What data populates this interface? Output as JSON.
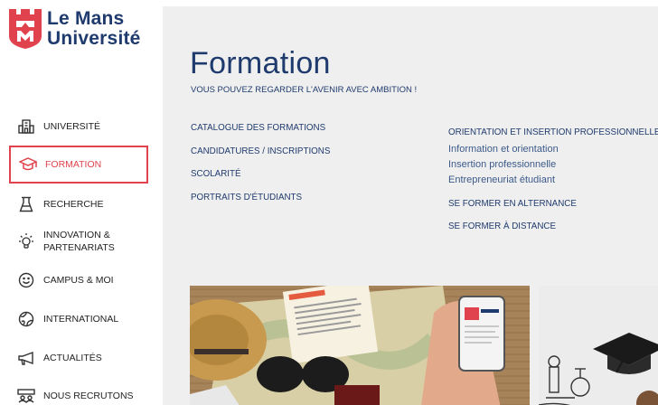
{
  "brand": {
    "line1": "Le Mans",
    "line2": "Université",
    "color": "#1f3b6e",
    "logo_color": "#e0434d"
  },
  "nav": {
    "active_color": "#e0434d",
    "items": [
      {
        "label": "UNIVERSITÉ",
        "icon": "building-icon"
      },
      {
        "label": "FORMATION",
        "icon": "graduation-cap-icon",
        "active": true
      },
      {
        "label": "RECHERCHE",
        "icon": "flask-icon"
      },
      {
        "label": "INNOVATION &",
        "label2": "PARTENARIATS",
        "icon": "lightbulb-icon"
      },
      {
        "label": "CAMPUS & MOI",
        "icon": "smiley-icon"
      },
      {
        "label": "INTERNATIONAL",
        "icon": "globe-icon"
      },
      {
        "label": "ACTUALITÉS",
        "icon": "megaphone-icon"
      },
      {
        "label": "NOUS RECRUTONS",
        "icon": "people-icon"
      }
    ]
  },
  "main": {
    "title": "Formation",
    "subtitle": "VOUS POUVEZ REGARDER L'AVENIR AVEC AMBITION !",
    "col1": [
      "CATALOGUE DES FORMATIONS",
      "CANDIDATURES / INSCRIPTIONS",
      "SCOLARITÉ",
      "PORTRAITS D'ÉTUDIANTS"
    ],
    "col2": {
      "heading": "ORIENTATION ET INSERTION PROFESSIONNELLE",
      "links": [
        "Information et orientation",
        "Insertion professionnelle",
        "Entrepreneuriat étudiant"
      ],
      "heading2": "SE FORMER EN ALTERNANCE",
      "heading3": "SE FORMER À DISTANCE"
    }
  }
}
